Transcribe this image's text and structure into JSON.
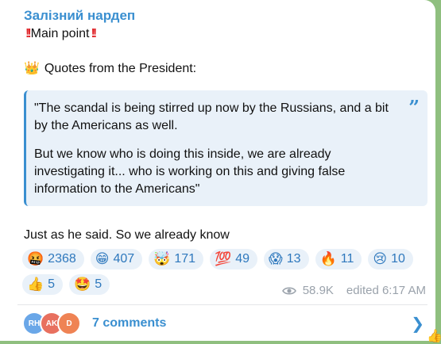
{
  "channel": {
    "name": "Залізний нардеп"
  },
  "post": {
    "main_point": "Main point",
    "quotes_intro": "Quotes from the President:",
    "quote_paragraphs": [
      "\"The scandal is being stirred up now by the Russians, and a bit by the Americans as well.",
      "But we know who is doing this inside, we are already investigating it... who is working on this and giving false information to the Americans\""
    ],
    "after_text": "Just as he said. So we already know"
  },
  "reactions": [
    {
      "emoji": "🤬",
      "count": "2368"
    },
    {
      "emoji": "😁",
      "count": "407"
    },
    {
      "emoji": "🤯",
      "count": "171"
    },
    {
      "emoji": "💯",
      "count": "49"
    },
    {
      "emoji": "😱",
      "count": "13"
    },
    {
      "emoji": "🔥",
      "count": "11"
    },
    {
      "emoji": "😢",
      "count": "10"
    },
    {
      "emoji": "👍",
      "count": "5"
    },
    {
      "emoji": "🤩",
      "count": "5"
    }
  ],
  "meta": {
    "views": "58.9K",
    "edited": "edited 6:17 AM"
  },
  "comments": {
    "label": "7 comments",
    "avatars": [
      {
        "initials": "RH",
        "color": "#6aa7e8"
      },
      {
        "initials": "AK",
        "color": "#e8705f"
      },
      {
        "initials": "D",
        "color": "#ef8354"
      }
    ]
  },
  "icons": {
    "main_point_marks": "‼️",
    "crown": "👑",
    "corner": "👍"
  },
  "colors": {
    "accent": "#3a8fd0",
    "quote_bg": "#e9f1f9",
    "background": "#8fbf7f"
  }
}
